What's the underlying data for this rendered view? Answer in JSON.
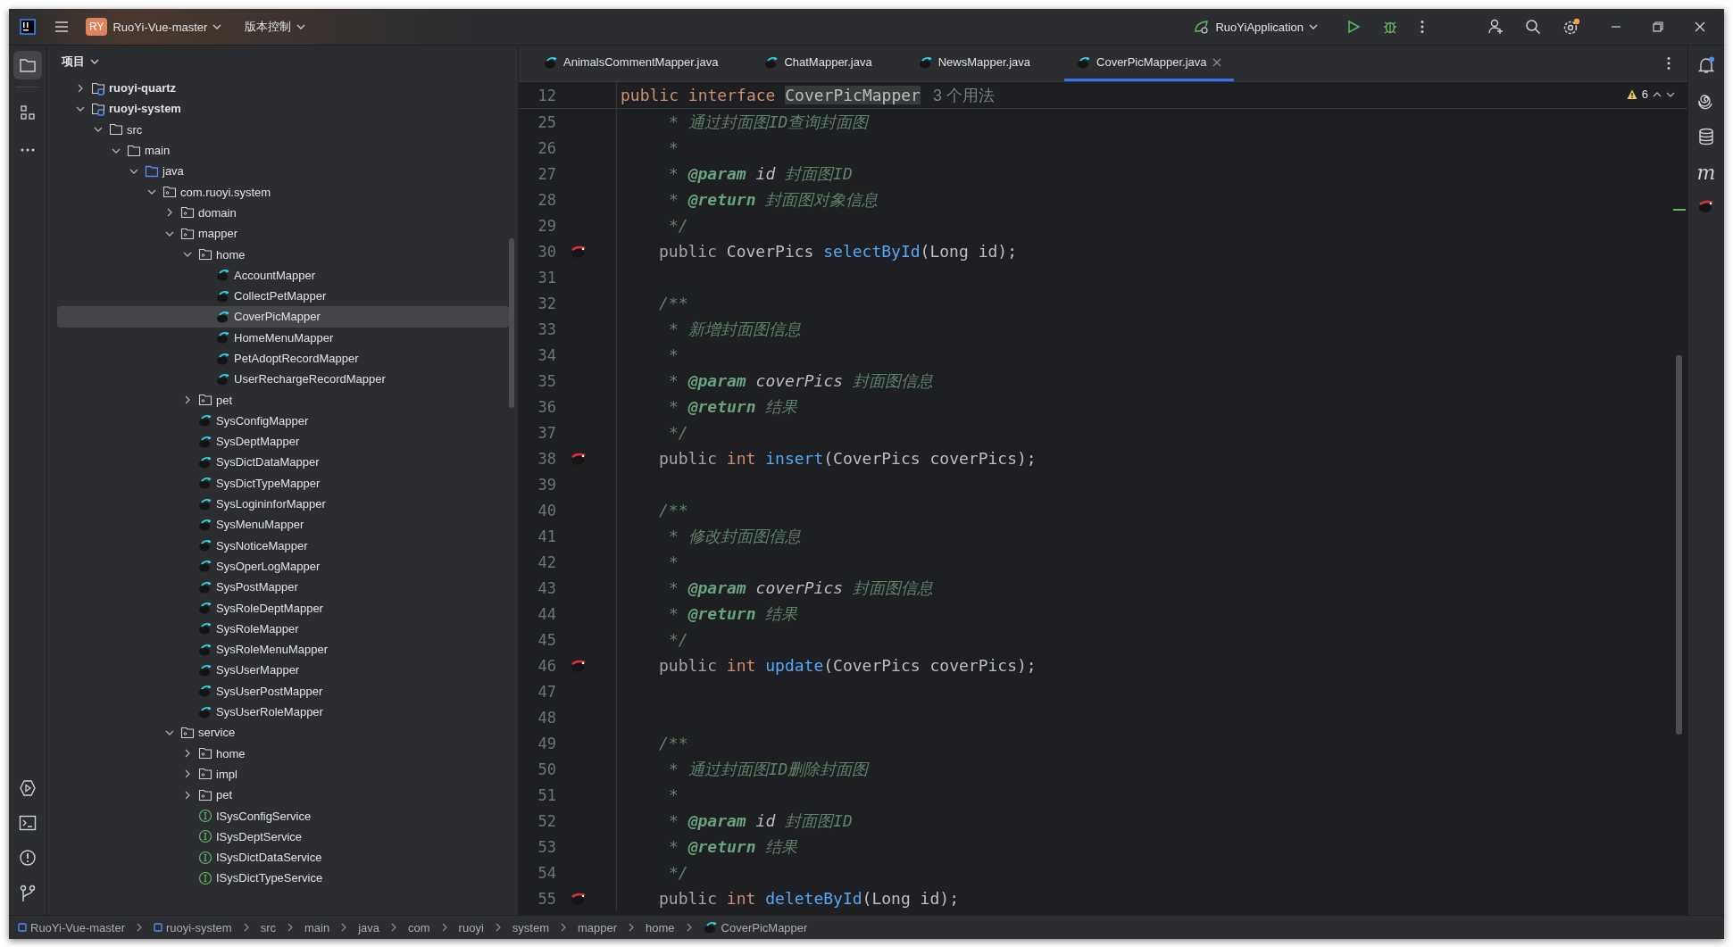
{
  "titlebar": {
    "project_badge": "RY",
    "project": "RuoYi-Vue-master",
    "vcs": "版本控制",
    "run_config": "RuoYiApplication",
    "settings_badge": true
  },
  "left_toolbar": {
    "top": [
      {
        "kind": "project",
        "selected": true
      },
      {
        "kind": "structure",
        "selected": false
      },
      {
        "kind": "more",
        "selected": false
      }
    ],
    "bottom": [
      {
        "kind": "run"
      },
      {
        "kind": "terminal"
      },
      {
        "kind": "problems"
      },
      {
        "kind": "git"
      }
    ]
  },
  "project": {
    "title": "项目",
    "tree": [
      {
        "label": "ruoyi-quartz",
        "kind": "module",
        "expanded": false,
        "selected": false
      },
      {
        "label": "ruoyi-system",
        "kind": "module",
        "expanded": true,
        "selected": false,
        "children": [
          {
            "label": "src",
            "kind": "folder",
            "expanded": true,
            "selected": false,
            "children": [
              {
                "label": "main",
                "kind": "folder",
                "expanded": true,
                "selected": false,
                "children": [
                  {
                    "label": "java",
                    "kind": "source",
                    "expanded": true,
                    "selected": false,
                    "children": [
                      {
                        "label": "com.ruoyi.system",
                        "kind": "package",
                        "expanded": true,
                        "selected": false,
                        "children": [
                          {
                            "label": "domain",
                            "kind": "package",
                            "expanded": false,
                            "selected": false
                          },
                          {
                            "label": "mapper",
                            "kind": "package",
                            "expanded": true,
                            "selected": false,
                            "children": [
                              {
                                "label": "home",
                                "kind": "package",
                                "expanded": true,
                                "selected": false,
                                "children": [
                                  {
                                    "label": "AccountMapper",
                                    "kind": "mapper",
                                    "selected": false
                                  },
                                  {
                                    "label": "CollectPetMapper",
                                    "kind": "mapper",
                                    "selected": false
                                  },
                                  {
                                    "label": "CoverPicMapper",
                                    "kind": "mapper",
                                    "selected": true
                                  },
                                  {
                                    "label": "HomeMenuMapper",
                                    "kind": "mapper",
                                    "selected": false
                                  },
                                  {
                                    "label": "PetAdoptRecordMapper",
                                    "kind": "mapper",
                                    "selected": false
                                  },
                                  {
                                    "label": "UserRechargeRecordMapper",
                                    "kind": "mapper",
                                    "selected": false
                                  }
                                ]
                              },
                              {
                                "label": "pet",
                                "kind": "package",
                                "expanded": false,
                                "selected": false
                              },
                              {
                                "label": "SysConfigMapper",
                                "kind": "mapper",
                                "selected": false
                              },
                              {
                                "label": "SysDeptMapper",
                                "kind": "mapper",
                                "selected": false
                              },
                              {
                                "label": "SysDictDataMapper",
                                "kind": "mapper",
                                "selected": false
                              },
                              {
                                "label": "SysDictTypeMapper",
                                "kind": "mapper",
                                "selected": false
                              },
                              {
                                "label": "SysLogininforMapper",
                                "kind": "mapper",
                                "selected": false
                              },
                              {
                                "label": "SysMenuMapper",
                                "kind": "mapper",
                                "selected": false
                              },
                              {
                                "label": "SysNoticeMapper",
                                "kind": "mapper",
                                "selected": false
                              },
                              {
                                "label": "SysOperLogMapper",
                                "kind": "mapper",
                                "selected": false
                              },
                              {
                                "label": "SysPostMapper",
                                "kind": "mapper",
                                "selected": false
                              },
                              {
                                "label": "SysRoleDeptMapper",
                                "kind": "mapper",
                                "selected": false
                              },
                              {
                                "label": "SysRoleMapper",
                                "kind": "mapper",
                                "selected": false
                              },
                              {
                                "label": "SysRoleMenuMapper",
                                "kind": "mapper",
                                "selected": false
                              },
                              {
                                "label": "SysUserMapper",
                                "kind": "mapper",
                                "selected": false
                              },
                              {
                                "label": "SysUserPostMapper",
                                "kind": "mapper",
                                "selected": false
                              },
                              {
                                "label": "SysUserRoleMapper",
                                "kind": "mapper",
                                "selected": false
                              }
                            ]
                          },
                          {
                            "label": "service",
                            "kind": "package",
                            "expanded": true,
                            "selected": false,
                            "children": [
                              {
                                "label": "home",
                                "kind": "package",
                                "expanded": false,
                                "selected": false
                              },
                              {
                                "label": "impl",
                                "kind": "package",
                                "expanded": false,
                                "selected": false
                              },
                              {
                                "label": "pet",
                                "kind": "package",
                                "expanded": false,
                                "selected": false
                              },
                              {
                                "label": "ISysConfigService",
                                "kind": "interface",
                                "selected": false
                              },
                              {
                                "label": "ISysDeptService",
                                "kind": "interface",
                                "selected": false
                              },
                              {
                                "label": "ISysDictDataService",
                                "kind": "interface",
                                "selected": false
                              },
                              {
                                "label": "ISysDictTypeService",
                                "kind": "interface",
                                "selected": false
                              }
                            ]
                          }
                        ]
                      }
                    ]
                  }
                ]
              }
            ]
          }
        ]
      }
    ]
  },
  "editor": {
    "tabs": [
      {
        "label": "AnimalsCommentMapper.java",
        "selected": false
      },
      {
        "label": "ChatMapper.java",
        "selected": false
      },
      {
        "label": "NewsMapper.java",
        "selected": false
      },
      {
        "label": "CoverPicMapper.java",
        "selected": true
      }
    ],
    "warnings": "6",
    "sticky": {
      "number": "12",
      "tokens": [
        {
          "kind": "keyword",
          "text": "public interface "
        },
        {
          "kind": "highlight",
          "text": "CoverPicMapper"
        }
      ],
      "hint": "3 个用法"
    },
    "lines": [
      {
        "number": "25",
        "kind": "doc",
        "nav_marker": false,
        "tokens": [
          {
            "kind": "comment",
            "text": "* 通过封面图ID查询封面图"
          }
        ]
      },
      {
        "number": "26",
        "kind": "doc",
        "nav_marker": false,
        "tokens": [
          {
            "kind": "comment",
            "text": "*"
          }
        ]
      },
      {
        "number": "27",
        "kind": "doc",
        "nav_marker": false,
        "tokens": [
          {
            "kind": "comment",
            "text": "* "
          },
          {
            "kind": "doc-tag",
            "text": "@param"
          },
          {
            "kind": "doc-param",
            "text": " id"
          },
          {
            "kind": "comment",
            "text": " 封面图ID"
          }
        ]
      },
      {
        "number": "28",
        "kind": "doc",
        "nav_marker": false,
        "tokens": [
          {
            "kind": "comment",
            "text": "* "
          },
          {
            "kind": "doc-tag",
            "text": "@return"
          },
          {
            "kind": "comment",
            "text": " 封面图对象信息"
          }
        ]
      },
      {
        "number": "29",
        "kind": "doc",
        "nav_marker": false,
        "tokens": [
          {
            "kind": "comment",
            "text": "*/"
          }
        ]
      },
      {
        "number": "30",
        "kind": "body",
        "nav_marker": true,
        "tokens": [
          {
            "kind": "muted",
            "text": "public "
          },
          {
            "kind": "plain",
            "text": "CoverPics "
          },
          {
            "kind": "method",
            "text": "selectById"
          },
          {
            "kind": "plain",
            "text": "(Long id);"
          }
        ]
      },
      {
        "number": "31",
        "kind": "blank",
        "nav_marker": false
      },
      {
        "number": "32",
        "kind": "body",
        "nav_marker": false,
        "tokens": [
          {
            "kind": "comment",
            "text": "/**"
          }
        ]
      },
      {
        "number": "33",
        "kind": "doc",
        "nav_marker": false,
        "tokens": [
          {
            "kind": "comment",
            "text": "* 新增封面图信息"
          }
        ]
      },
      {
        "number": "34",
        "kind": "doc",
        "nav_marker": false,
        "tokens": [
          {
            "kind": "comment",
            "text": "*"
          }
        ]
      },
      {
        "number": "35",
        "kind": "doc",
        "nav_marker": false,
        "tokens": [
          {
            "kind": "comment",
            "text": "* "
          },
          {
            "kind": "doc-tag",
            "text": "@param"
          },
          {
            "kind": "doc-param",
            "text": " coverPics"
          },
          {
            "kind": "comment",
            "text": " 封面图信息"
          }
        ]
      },
      {
        "number": "36",
        "kind": "doc",
        "nav_marker": false,
        "tokens": [
          {
            "kind": "comment",
            "text": "* "
          },
          {
            "kind": "doc-tag",
            "text": "@return"
          },
          {
            "kind": "comment",
            "text": " 结果"
          }
        ]
      },
      {
        "number": "37",
        "kind": "doc",
        "nav_marker": false,
        "tokens": [
          {
            "kind": "comment",
            "text": "*/"
          }
        ]
      },
      {
        "number": "38",
        "kind": "body",
        "nav_marker": true,
        "tokens": [
          {
            "kind": "muted",
            "text": "public "
          },
          {
            "kind": "keyword",
            "text": "int "
          },
          {
            "kind": "method",
            "text": "insert"
          },
          {
            "kind": "plain",
            "text": "(CoverPics coverPics);"
          }
        ]
      },
      {
        "number": "39",
        "kind": "blank",
        "nav_marker": false
      },
      {
        "number": "40",
        "kind": "body",
        "nav_marker": false,
        "tokens": [
          {
            "kind": "comment",
            "text": "/**"
          }
        ]
      },
      {
        "number": "41",
        "kind": "doc",
        "nav_marker": false,
        "tokens": [
          {
            "kind": "comment",
            "text": "* 修改封面图信息"
          }
        ]
      },
      {
        "number": "42",
        "kind": "doc",
        "nav_marker": false,
        "tokens": [
          {
            "kind": "comment",
            "text": "*"
          }
        ]
      },
      {
        "number": "43",
        "kind": "doc",
        "nav_marker": false,
        "tokens": [
          {
            "kind": "comment",
            "text": "* "
          },
          {
            "kind": "doc-tag",
            "text": "@param"
          },
          {
            "kind": "doc-param",
            "text": " coverPics"
          },
          {
            "kind": "comment",
            "text": " 封面图信息"
          }
        ]
      },
      {
        "number": "44",
        "kind": "doc",
        "nav_marker": false,
        "tokens": [
          {
            "kind": "comment",
            "text": "* "
          },
          {
            "kind": "doc-tag",
            "text": "@return"
          },
          {
            "kind": "comment",
            "text": " 结果"
          }
        ]
      },
      {
        "number": "45",
        "kind": "doc",
        "nav_marker": false,
        "tokens": [
          {
            "kind": "comment",
            "text": "*/"
          }
        ]
      },
      {
        "number": "46",
        "kind": "body",
        "nav_marker": true,
        "tokens": [
          {
            "kind": "muted",
            "text": "public "
          },
          {
            "kind": "keyword",
            "text": "int "
          },
          {
            "kind": "method",
            "text": "update"
          },
          {
            "kind": "plain",
            "text": "(CoverPics coverPics);"
          }
        ]
      },
      {
        "number": "47",
        "kind": "blank",
        "nav_marker": false
      },
      {
        "number": "48",
        "kind": "blank",
        "nav_marker": false
      },
      {
        "number": "49",
        "kind": "body",
        "nav_marker": false,
        "tokens": [
          {
            "kind": "comment",
            "text": "/**"
          }
        ]
      },
      {
        "number": "50",
        "kind": "doc",
        "nav_marker": false,
        "tokens": [
          {
            "kind": "comment",
            "text": "* 通过封面图ID删除封面图"
          }
        ]
      },
      {
        "number": "51",
        "kind": "doc",
        "nav_marker": false,
        "tokens": [
          {
            "kind": "comment",
            "text": "*"
          }
        ]
      },
      {
        "number": "52",
        "kind": "doc",
        "nav_marker": false,
        "tokens": [
          {
            "kind": "comment",
            "text": "* "
          },
          {
            "kind": "doc-tag",
            "text": "@param"
          },
          {
            "kind": "doc-param",
            "text": " id"
          },
          {
            "kind": "comment",
            "text": " 封面图ID"
          }
        ]
      },
      {
        "number": "53",
        "kind": "doc",
        "nav_marker": false,
        "tokens": [
          {
            "kind": "comment",
            "text": "* "
          },
          {
            "kind": "doc-tag",
            "text": "@return"
          },
          {
            "kind": "comment",
            "text": " 结果"
          }
        ]
      },
      {
        "number": "54",
        "kind": "doc",
        "nav_marker": false,
        "tokens": [
          {
            "kind": "comment",
            "text": "*/"
          }
        ]
      },
      {
        "number": "55",
        "kind": "body",
        "nav_marker": true,
        "tokens": [
          {
            "kind": "muted",
            "text": "public "
          },
          {
            "kind": "keyword",
            "text": "int "
          },
          {
            "kind": "method",
            "text": "deleteById"
          },
          {
            "kind": "plain",
            "text": "(Long id);"
          }
        ]
      }
    ]
  },
  "right_toolbar": [
    {
      "kind": "notifications",
      "badge": true
    },
    {
      "kind": "assistant"
    },
    {
      "kind": "database"
    },
    {
      "kind": "label",
      "text": "m"
    },
    {
      "kind": "mapper"
    }
  ],
  "breadcrumbs": [
    {
      "label": "RuoYi-Vue-master",
      "kind": "module"
    },
    {
      "label": "ruoyi-system",
      "kind": "module"
    },
    {
      "label": "src",
      "kind": "plain"
    },
    {
      "label": "main",
      "kind": "plain"
    },
    {
      "label": "java",
      "kind": "plain"
    },
    {
      "label": "com",
      "kind": "plain"
    },
    {
      "label": "ruoyi",
      "kind": "plain"
    },
    {
      "label": "system",
      "kind": "plain"
    },
    {
      "label": "mapper",
      "kind": "plain"
    },
    {
      "label": "home",
      "kind": "plain"
    },
    {
      "label": "CoverPicMapper",
      "kind": "mapper"
    }
  ]
}
